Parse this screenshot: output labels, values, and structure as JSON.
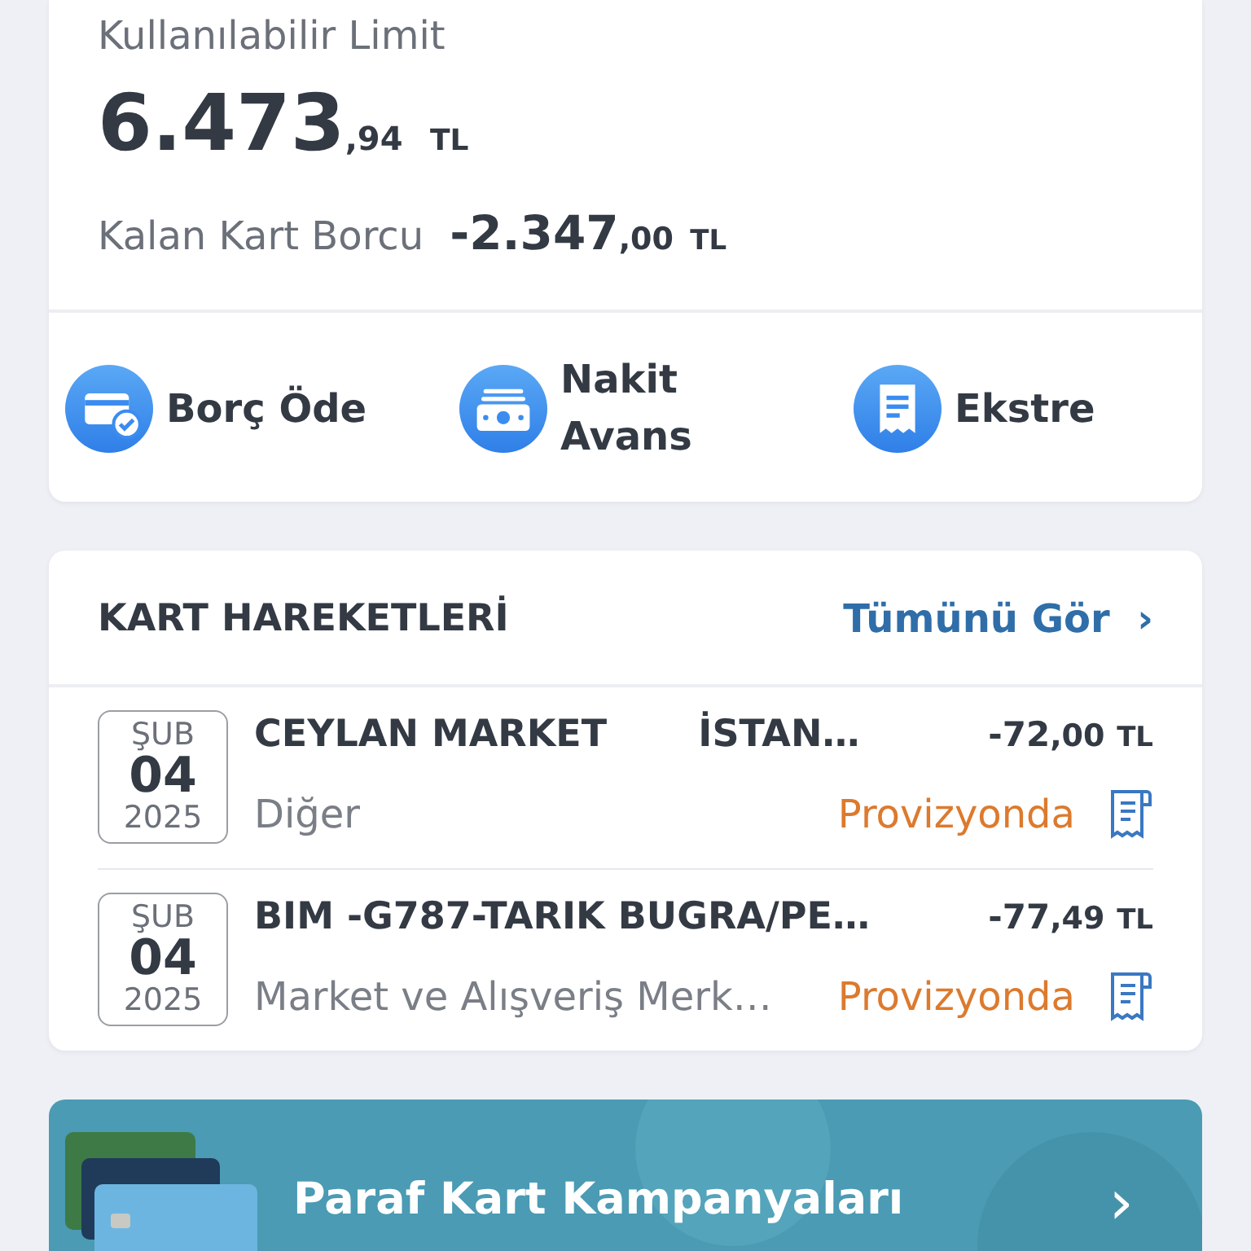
{
  "limit_card": {
    "label": "Kullanılabilir Limit",
    "amount": {
      "main": "6.473",
      "fraction": ",94",
      "currency": "TL"
    },
    "debt_label": "Kalan Kart Borcu",
    "debt": {
      "main": "-2.347",
      "fraction": ",00",
      "currency": "TL"
    }
  },
  "actions": [
    {
      "kind": "pay",
      "label": "Borç Öde"
    },
    {
      "kind": "cash",
      "label": "Nakit Avans"
    },
    {
      "kind": "statement",
      "label": "Ekstre"
    }
  ],
  "transactions": {
    "title": "KART HAREKETLERİ",
    "see_all": "Tümünü Gör",
    "chevron": "›",
    "rows": [
      {
        "month": "ŞUB",
        "day": "04",
        "year": "2025",
        "merchant": "CEYLAN MARKET       İSTAN…",
        "category": "Diğer",
        "amount": {
          "main": "-72",
          "fraction": ",00",
          "currency": "TL"
        },
        "status": "Provizyonda"
      },
      {
        "month": "ŞUB",
        "day": "04",
        "year": "2025",
        "merchant": "BIM -G787-TARIK BUGRA/PE…",
        "category": "Market ve Alışveriş Merk…",
        "amount": {
          "main": "-77",
          "fraction": ",49",
          "currency": "TL"
        },
        "status": "Provizyonda"
      }
    ]
  },
  "banner": {
    "title": "Paraf Kart Kampanyaları",
    "chevron": "›"
  }
}
